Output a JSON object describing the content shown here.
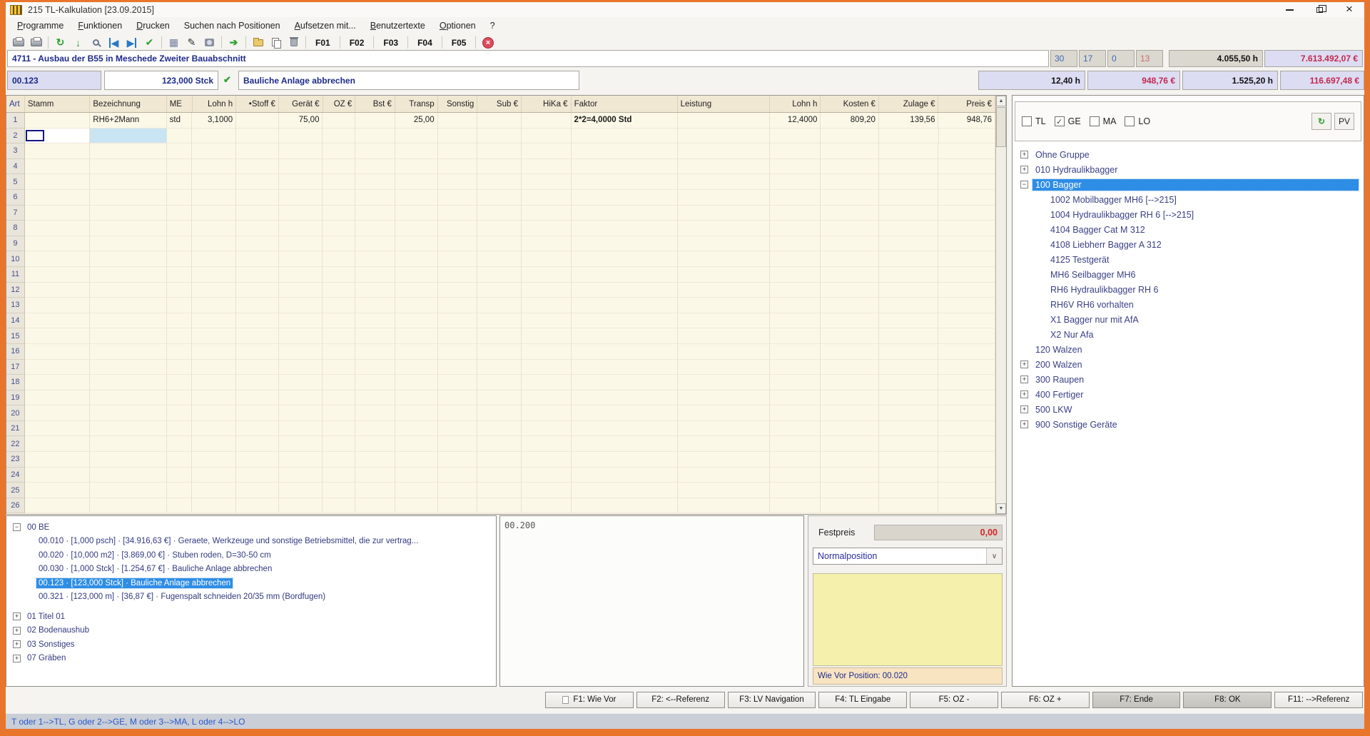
{
  "colors": {
    "accent_orange": "#E8752A",
    "selection_blue": "#2E8DE5",
    "money_red": "#C2294E",
    "navy": "#1C2A8A",
    "grid_cream": "#FCF8E8",
    "highlight_cell": "#C9E5F4"
  },
  "window": {
    "title": "215 TL-Kalkulation [23.09.2015]",
    "icon": "app-icon"
  },
  "menu": {
    "items": [
      {
        "label": "Programme",
        "accel": "P"
      },
      {
        "label": "Funktionen",
        "accel": "F"
      },
      {
        "label": "Drucken",
        "accel": "D"
      },
      {
        "label": "Suchen nach Positionen"
      },
      {
        "label": "Aufsetzen mit...",
        "accel": "A"
      },
      {
        "label": "Benutzertexte",
        "accel": "B"
      },
      {
        "label": "Optionen",
        "accel": "O"
      },
      {
        "label": "?"
      }
    ]
  },
  "toolbar": {
    "items": [
      {
        "type": "icon",
        "name": "print-icon",
        "css": "ic-print"
      },
      {
        "type": "icon",
        "name": "print-preview-icon",
        "css": "ic-print"
      },
      {
        "type": "sep"
      },
      {
        "type": "icon",
        "name": "refresh-icon",
        "glyph": "↻",
        "css": "c-green b"
      },
      {
        "type": "icon",
        "name": "download-icon",
        "glyph": "↓",
        "css": "c-green b"
      },
      {
        "type": "icon",
        "name": "search-icon",
        "css": "ic-search"
      },
      {
        "type": "icon",
        "name": "first-record-icon",
        "glyph": "◀",
        "css": "c-blue bar-left"
      },
      {
        "type": "icon",
        "name": "last-record-icon",
        "glyph": "▶",
        "css": "c-blue bar-right"
      },
      {
        "type": "icon",
        "name": "confirm-icon",
        "glyph": "✔",
        "css": "c-green"
      },
      {
        "type": "sep"
      },
      {
        "type": "icon",
        "name": "calculator-icon",
        "glyph": "▦",
        "css": "c-slate"
      },
      {
        "type": "icon",
        "name": "edit-icon",
        "glyph": "✎",
        "css": "c-dark"
      },
      {
        "type": "icon",
        "name": "photo-icon",
        "css": "ic-photo"
      },
      {
        "type": "sep"
      },
      {
        "type": "icon",
        "name": "forward-icon",
        "glyph": "➔",
        "css": "c-green b"
      },
      {
        "type": "sep"
      },
      {
        "type": "icon",
        "name": "import-icon",
        "css": "ic-folder"
      },
      {
        "type": "icon",
        "name": "copy-icon",
        "css": "ic-copy"
      },
      {
        "type": "icon",
        "name": "delete-icon",
        "css": "ic-trash"
      },
      {
        "type": "sep"
      },
      {
        "type": "fkey",
        "label": "F01"
      },
      {
        "type": "sep"
      },
      {
        "type": "fkey",
        "label": "F02"
      },
      {
        "type": "sep"
      },
      {
        "type": "fkey",
        "label": "F03"
      },
      {
        "type": "sep"
      },
      {
        "type": "fkey",
        "label": "F04"
      },
      {
        "type": "sep"
      },
      {
        "type": "fkey",
        "label": "F05"
      },
      {
        "type": "sep"
      },
      {
        "type": "icon",
        "name": "abort-icon",
        "glyph": "×",
        "css": "ic-abort"
      }
    ]
  },
  "project_header": {
    "title": "4711 - Ausbau der B55 in Meschede Zweiter Bauabschnitt",
    "counts": [
      {
        "value": "30",
        "alert": false
      },
      {
        "value": "17",
        "alert": false
      },
      {
        "value": "0",
        "alert": false
      },
      {
        "value": "13",
        "alert": true
      }
    ],
    "hours": "4.055,50 h",
    "total": "7.613.492,07 €"
  },
  "position_header": {
    "number": "00.123",
    "quantity": "123,000 Stck",
    "check_icon": "✔",
    "description": "Bauliche Anlage abbrechen",
    "lohn_h": "12,40 h",
    "kosten": "948,76 €",
    "gesamt_h": "1.525,20 h",
    "gesamt": "116.697,48 €"
  },
  "grid": {
    "columns": [
      "Art",
      "Stamm",
      "Bezeichnung",
      "ME",
      "Lohn h",
      "•Stoff €",
      "Gerät €",
      "OZ €",
      "Bst €",
      "Transp",
      "Sonstig",
      "Sub €",
      "HiKa €",
      "Faktor",
      "Leistung",
      "Lohn h",
      "Kosten €",
      "Zulage €",
      "Preis €"
    ],
    "row_count": 26,
    "rows": [
      {
        "row": 1,
        "cells": [
          "",
          "RH6+2Mann",
          "std",
          "3,1000",
          "",
          "75,00",
          "",
          "",
          "25,00",
          "",
          "",
          "",
          "2*2=4,0000 Std",
          "",
          "12,4000",
          "809,20",
          "139,56",
          "948,76"
        ]
      }
    ],
    "cursor": {
      "row": 2,
      "column": "Stamm"
    },
    "highlight": {
      "row": 2,
      "column": "Bezeichnung"
    }
  },
  "machine_panel": {
    "filters": [
      {
        "label": "TL",
        "checked": false
      },
      {
        "label": "GE",
        "checked": true
      },
      {
        "label": "MA",
        "checked": false
      },
      {
        "label": "LO",
        "checked": false
      }
    ],
    "refresh_button_icon": "refresh-icon",
    "pv_button": "PV",
    "tree": [
      {
        "label": "Ohne Gruppe",
        "level": 0,
        "exp": "plus"
      },
      {
        "label": "010 Hydraulikbagger",
        "level": 0,
        "exp": "plus"
      },
      {
        "label": "100 Bagger",
        "level": 0,
        "exp": "minus",
        "selected": true
      },
      {
        "label": "1002 Mobilbagger MH6 [-->215]",
        "level": 1
      },
      {
        "label": "1004 Hydraulikbagger RH 6 [-->215]",
        "level": 1
      },
      {
        "label": "4104 Bagger Cat M 312",
        "level": 1
      },
      {
        "label": "4108 Liebherr Bagger A 312",
        "level": 1
      },
      {
        "label": "4125 Testgerät",
        "level": 1
      },
      {
        "label": "MH6 Seilbagger MH6",
        "level": 1
      },
      {
        "label": "RH6 Hydraulikbagger RH 6",
        "level": 1
      },
      {
        "label": "RH6V RH6 vorhalten",
        "level": 1
      },
      {
        "label": "X1 Bagger nur mit AfA",
        "level": 1
      },
      {
        "label": "X2 Nur Afa",
        "level": 1
      },
      {
        "label": "120 Walzen",
        "level": 0,
        "exp": ""
      },
      {
        "label": "200 Walzen",
        "level": 0,
        "exp": "plus"
      },
      {
        "label": "300 Raupen",
        "level": 0,
        "exp": "plus"
      },
      {
        "label": "400 Fertiger",
        "level": 0,
        "exp": "plus"
      },
      {
        "label": "500 LKW",
        "level": 0,
        "exp": "plus"
      },
      {
        "label": "900 Sonstige Geräte",
        "level": 0,
        "exp": "plus"
      }
    ]
  },
  "lv_tree": {
    "items": [
      {
        "label": "00 BE",
        "level": 0,
        "exp": "minus"
      },
      {
        "label": "00.010 · [1,000 psch] · [34.916,63 €] · Geraete, Werkzeuge und sonstige Betriebsmittel, die zur vertrag...",
        "level": 1
      },
      {
        "label": "00.020 · [10,000 m2] · [3.869,00 €] · Stuben roden, D=30-50 cm",
        "level": 1
      },
      {
        "label": "00.030 · [1,000 Stck] · [1.254,67 €] · Bauliche Anlage abbrechen",
        "level": 1
      },
      {
        "label": "00.123 · [123,000 Stck] · Bauliche Anlage abbrechen",
        "level": 1,
        "selected": true
      },
      {
        "label": "00.321 · [123,000 m] · [36,87 €] · Fugenspalt schneiden 20/35 mm (Bordfugen)",
        "level": 1
      },
      {
        "label": "01 Titel 01",
        "level": 0,
        "exp": "plus",
        "gap": true
      },
      {
        "label": "02 Bodenaushub",
        "level": 0,
        "exp": "plus"
      },
      {
        "label": "03 Sonstiges",
        "level": 0,
        "exp": "plus"
      },
      {
        "label": "07 Gräben",
        "level": 0,
        "exp": "plus"
      }
    ]
  },
  "notes_panel": {
    "text": "00.200"
  },
  "detail_panel": {
    "festpreis_label": "Festpreis",
    "festpreis_value": "0,00",
    "position_type": "Normalposition",
    "hint": "Wie Vor Position: 00.020"
  },
  "function_bar": {
    "buttons": [
      {
        "label": "F1: Wie Vor",
        "icon": "page-icon"
      },
      {
        "label": "F2: <--Referenz"
      },
      {
        "label": "F3: LV Navigation"
      },
      {
        "label": "F4: TL Eingabe"
      },
      {
        "label": "F5: OZ -"
      },
      {
        "label": "F6: OZ +"
      },
      {
        "label": "F7: Ende",
        "dark": true
      },
      {
        "label": "F8: OK",
        "dark": true
      },
      {
        "label": "F11: -->Referenz"
      }
    ]
  },
  "status_bar": {
    "text": "T oder 1-->TL, G oder 2-->GE, M oder 3-->MA, L oder 4-->LO"
  }
}
